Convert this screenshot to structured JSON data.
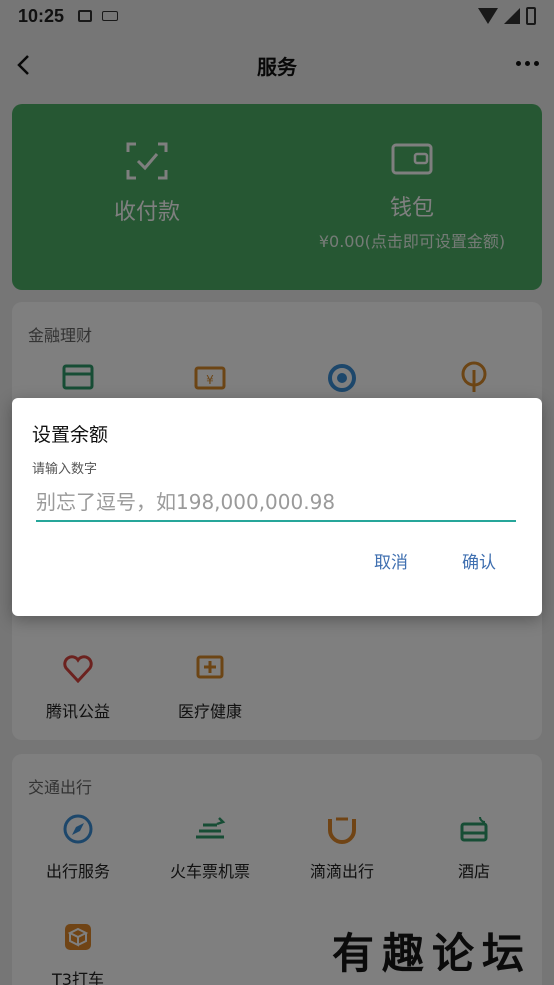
{
  "status_bar": {
    "time": "10:25"
  },
  "header": {
    "title": "服务"
  },
  "green_card": {
    "pay": {
      "label": "收付款"
    },
    "wallet": {
      "label": "钱包",
      "balance_text": "¥0.00(点击即可设置金额)"
    }
  },
  "finance": {
    "title": "金融理财"
  },
  "charity": {
    "items": [
      {
        "label": "腾讯公益",
        "icon": "heart-icon"
      },
      {
        "label": "医疗健康",
        "icon": "medical-cross-icon"
      }
    ]
  },
  "transport": {
    "title": "交通出行",
    "items": [
      {
        "label": "出行服务",
        "icon": "compass-icon"
      },
      {
        "label": "火车票机票",
        "icon": "train-icon"
      },
      {
        "label": "滴滴出行",
        "icon": "didi-icon"
      },
      {
        "label": "酒店",
        "icon": "bed-icon"
      },
      {
        "label": "T3打车",
        "icon": "cube-icon"
      }
    ]
  },
  "dialog": {
    "title": "设置余额",
    "hint": "请输入数字",
    "input_placeholder": "别忘了逗号，如198,000,000.98",
    "input_value": "",
    "cancel_label": "取消",
    "confirm_label": "确认"
  },
  "watermark": "有趣论坛",
  "colors": {
    "green_card": "#4caf66",
    "accent": "#26a69a",
    "dialog_button": "#3f6fb0"
  }
}
